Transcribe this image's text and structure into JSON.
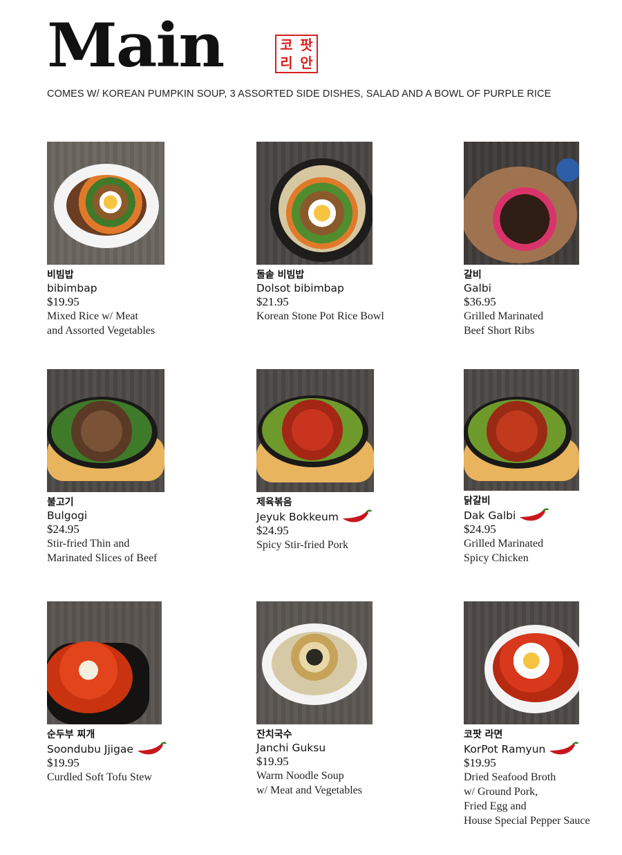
{
  "header": {
    "title": "Main",
    "seal_chars": [
      "코",
      "팟",
      "리",
      "안"
    ],
    "subtitle": "COMES W/ KOREAN PUMPKIN SOUP, 3 ASSORTED SIDE DISHES, SALAD AND A BOWL OF PURPLE RICE"
  },
  "colors": {
    "seal": "#d81e1e",
    "pepper": "#c8161d"
  },
  "items": [
    {
      "korean": "비빔밥",
      "name": "bibimbap",
      "price": "$19.95",
      "desc1": "Mixed Rice w/ Meat",
      "desc2": "and Assorted Vegetables",
      "desc3": "",
      "desc4": "",
      "spicy": false
    },
    {
      "korean": "돌솥 비빔밥",
      "name": "Dolsot bibimbap",
      "price": "$21.95",
      "desc1": "Korean Stone Pot Rice Bowl",
      "desc2": "",
      "desc3": "",
      "desc4": "",
      "spicy": false
    },
    {
      "korean": "갈비",
      "name": "Galbi",
      "price": "$36.95",
      "desc1": "Grilled Marinated",
      "desc2": "Beef Short Ribs",
      "desc3": "",
      "desc4": "",
      "spicy": false
    },
    {
      "korean": "불고기",
      "name": "Bulgogi",
      "price": "$24.95",
      "desc1": "Stir-fried Thin and",
      "desc2": "Marinated Slices of Beef",
      "desc3": "",
      "desc4": "",
      "spicy": false
    },
    {
      "korean": "제육볶음",
      "name": "Jeyuk Bokkeum",
      "price": "$24.95",
      "desc1": "Spicy Stir-fried Pork",
      "desc2": "",
      "desc3": "",
      "desc4": "",
      "spicy": true
    },
    {
      "korean": "닭갈비",
      "name": "Dak Galbi",
      "price": "$24.95",
      "desc1": "Grilled Marinated",
      "desc2": "Spicy Chicken",
      "desc3": "",
      "desc4": "",
      "spicy": true
    },
    {
      "korean": "순두부 찌개",
      "name": "Soondubu Jjigae",
      "price": "$19.95",
      "desc1": "Curdled Soft Tofu Stew",
      "desc2": "",
      "desc3": "",
      "desc4": "",
      "spicy": true
    },
    {
      "korean": "잔치국수",
      "name": "Janchi Guksu",
      "price": "$19.95",
      "desc1": "Warm Noodle Soup",
      "desc2": "w/ Meat and Vegetables",
      "desc3": "",
      "desc4": "",
      "spicy": false
    },
    {
      "korean": "코팟 라면",
      "name": "KorPot Ramyun",
      "price": "$19.95",
      "desc1": "Dried Seafood Broth",
      "desc2": "w/ Ground Pork,",
      "desc3": "Fried Egg and",
      "desc4": "House Special Pepper Sauce",
      "spicy": true
    }
  ]
}
